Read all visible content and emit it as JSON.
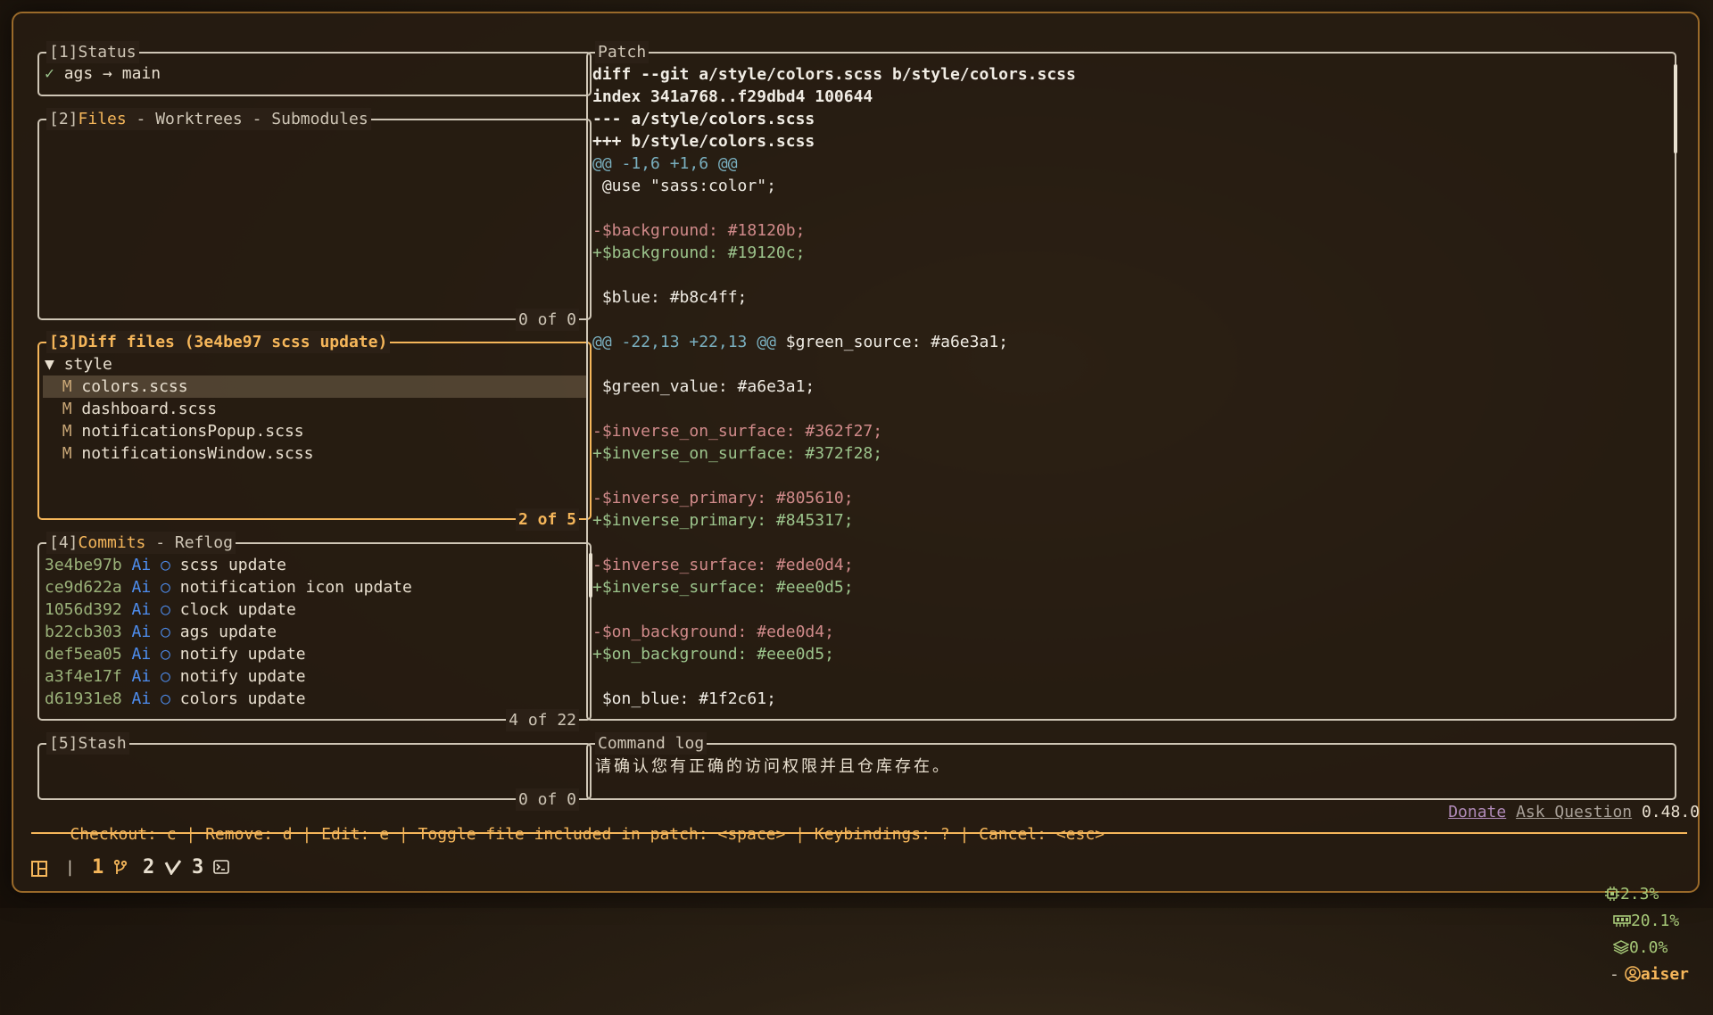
{
  "panels": {
    "status": {
      "title_num": "[1]",
      "title": "Status",
      "check": "✓",
      "repo": "ags",
      "arrow": "→",
      "branch": "main"
    },
    "files": {
      "title_num": "[2]",
      "tab_active": "Files",
      "tab_sep": " - ",
      "tab2": "Worktrees",
      "tab3": "Submodules",
      "count": "0 of 0"
    },
    "diff_files": {
      "title_num": "[3]",
      "title": "Diff files (3e4be97 scss update)",
      "count": "2 of 5",
      "folder_arrow": "▼",
      "folder": "style",
      "files": [
        {
          "status": "M",
          "name": "colors.scss"
        },
        {
          "status": "M",
          "name": "dashboard.scss"
        },
        {
          "status": "M",
          "name": "notificationsPopup.scss"
        },
        {
          "status": "M",
          "name": "notificationsWindow.scss"
        }
      ]
    },
    "commits": {
      "title_num": "[4]",
      "tab_active": "Commits",
      "tab_sep": " - ",
      "tab2": "Reflog",
      "count": "4 of 22",
      "items": [
        {
          "hash": "3e4be97b",
          "author": "Ai",
          "marker": "○",
          "msg": "scss update"
        },
        {
          "hash": "ce9d622a",
          "author": "Ai",
          "marker": "○",
          "msg": "notification icon update"
        },
        {
          "hash": "1056d392",
          "author": "Ai",
          "marker": "○",
          "msg": "clock update"
        },
        {
          "hash": "b22cb303",
          "author": "Ai",
          "marker": "○",
          "msg": "ags update"
        },
        {
          "hash": "def5ea05",
          "author": "Ai",
          "marker": "○",
          "msg": "notify update"
        },
        {
          "hash": "a3f4e17f",
          "author": "Ai",
          "marker": "○",
          "msg": "notify update"
        },
        {
          "hash": "d61931e8",
          "author": "Ai",
          "marker": "○",
          "msg": "colors update"
        }
      ]
    },
    "stash": {
      "title_num": "[5]",
      "title": "Stash",
      "count": "0 of 0"
    },
    "patch": {
      "title": "Patch",
      "lines": [
        {
          "kind": "meta",
          "text": "diff --git a/style/colors.scss b/style/colors.scss"
        },
        {
          "kind": "meta",
          "text": "index 341a768..f29dbd4 100644"
        },
        {
          "kind": "meta",
          "text": "--- a/style/colors.scss"
        },
        {
          "kind": "meta",
          "text": "+++ b/style/colors.scss"
        },
        {
          "kind": "hunk",
          "text": "@@ -1,6 +1,6 @@"
        },
        {
          "kind": "ctx",
          "text": " @use \"sass:color\";"
        },
        {
          "kind": "ctx",
          "text": ""
        },
        {
          "kind": "del",
          "text": "-$background: #18120b;"
        },
        {
          "kind": "add",
          "text": "+$background: #19120c;"
        },
        {
          "kind": "ctx",
          "text": ""
        },
        {
          "kind": "ctx",
          "text": " $blue: #b8c4ff;"
        },
        {
          "kind": "ctx",
          "text": ""
        },
        {
          "kind": "hunk2",
          "hunk": "@@ -22,13 +22,13 @@",
          "rest": " $green_source: #a6e3a1;"
        },
        {
          "kind": "ctx",
          "text": ""
        },
        {
          "kind": "ctx",
          "text": " $green_value: #a6e3a1;"
        },
        {
          "kind": "ctx",
          "text": ""
        },
        {
          "kind": "del",
          "text": "-$inverse_on_surface: #362f27;"
        },
        {
          "kind": "add",
          "text": "+$inverse_on_surface: #372f28;"
        },
        {
          "kind": "ctx",
          "text": ""
        },
        {
          "kind": "del",
          "text": "-$inverse_primary: #805610;"
        },
        {
          "kind": "add",
          "text": "+$inverse_primary: #845317;"
        },
        {
          "kind": "ctx",
          "text": ""
        },
        {
          "kind": "del",
          "text": "-$inverse_surface: #ede0d4;"
        },
        {
          "kind": "add",
          "text": "+$inverse_surface: #eee0d5;"
        },
        {
          "kind": "ctx",
          "text": ""
        },
        {
          "kind": "del",
          "text": "-$on_background: #ede0d4;"
        },
        {
          "kind": "add",
          "text": "+$on_background: #eee0d5;"
        },
        {
          "kind": "ctx",
          "text": ""
        },
        {
          "kind": "ctx",
          "text": " $on_blue: #1f2c61;"
        }
      ]
    },
    "command_log": {
      "title": "Command log",
      "text": "请确认您有正确的访问权限并且仓库存在。"
    }
  },
  "keybindings": [
    {
      "label": "Checkout: ",
      "key": "c"
    },
    {
      "label": "Remove: ",
      "key": "d"
    },
    {
      "label": "Edit: ",
      "key": "e"
    },
    {
      "label": "Toggle file included in patch: ",
      "key": "<space>"
    },
    {
      "label": "Keybindings: ",
      "key": "?"
    },
    {
      "label": "Cancel: ",
      "key": "<esc>"
    }
  ],
  "keybinding_sep": " | ",
  "links": {
    "donate": "Donate",
    "ask": "Ask Question",
    "version": "0.48.0"
  },
  "statusbar": {
    "workspace_sep": "|",
    "workspaces": [
      {
        "num": "1",
        "icon": "git-branch-icon"
      },
      {
        "num": "2",
        "icon": "checkmark-icon"
      },
      {
        "num": "3",
        "icon": "terminal-icon"
      }
    ],
    "cpu": "2.3%",
    "mem": "20.1%",
    "disk": "0.0%",
    "dash": "-",
    "user": "aiser"
  },
  "colors": {
    "accent": "#f5b65a",
    "border": "#cfc6b6",
    "hash": "#9bb27a",
    "author": "#4e8ef0",
    "del": "#d08a8a",
    "add": "#9cc48c",
    "hunk": "#7ab0c0",
    "stat": "#a6c878"
  }
}
